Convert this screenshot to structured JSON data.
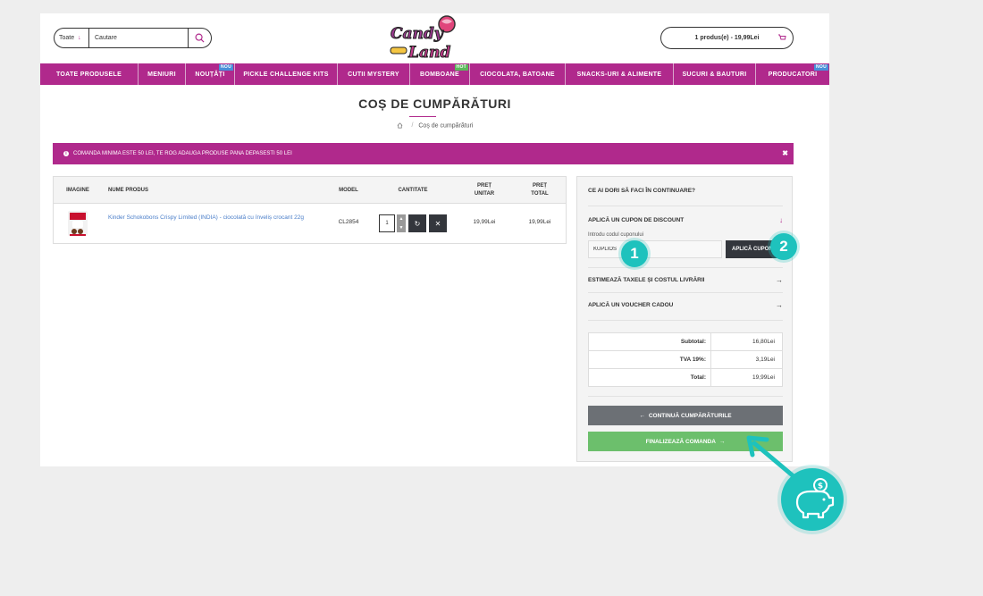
{
  "header": {
    "search": {
      "category": "Toate",
      "placeholder": "Cautare"
    },
    "cart_summary": "1 produs(e) - 19,99Lei"
  },
  "nav": {
    "items": [
      {
        "label": "TOATE PRODUSELE",
        "badge": ""
      },
      {
        "label": "MENIURI",
        "badge": ""
      },
      {
        "label": "NOUȚĂȚI",
        "badge": "NOU"
      },
      {
        "label": "PICKLE CHALLENGE KITS",
        "badge": ""
      },
      {
        "label": "CUTII MYSTERY",
        "badge": ""
      },
      {
        "label": "BOMBOANE",
        "badge": "HOT"
      },
      {
        "label": "CIOCOLATA, BATOANE",
        "badge": ""
      },
      {
        "label": "SNACKS-URI & ALIMENTE",
        "badge": ""
      },
      {
        "label": "SUCURI & BAUTURI",
        "badge": ""
      },
      {
        "label": "PRODUCATORI",
        "badge": "NOU"
      }
    ]
  },
  "page": {
    "title": "COȘ DE CUMPĂRĂTURI",
    "breadcrumb": "Coș de cumpărături",
    "alert": "COMANDA MINIMA ESTE 50 LEI, TE ROG ADAUGA PRODUSE PANA DEPASESTI 50 LEI"
  },
  "cart_table": {
    "headers": {
      "image": "IMAGINE",
      "name": "NUME PRODUS",
      "model": "MODEL",
      "quantity": "CANTITATE",
      "unit_price": "PREȚ UNITAR",
      "total_price": "PREȚ TOTAL"
    },
    "rows": [
      {
        "name": "Kinder Schokobons Crispy Limited (INDIA) - ciocolată cu înveliș crocant 22g",
        "model": "CL2854",
        "quantity": "1",
        "unit_price": "19,99Lei",
        "total_price": "19,99Lei"
      }
    ]
  },
  "side": {
    "heading": "CE AI DORI SĂ FACI ÎN CONTINUARE?",
    "coupon": {
      "title": "APLICĂ UN CUPON DE DISCOUNT",
      "label": "Introdu codul cuponului",
      "value": "KUPLIOS",
      "button": "APLICĂ CUPON"
    },
    "shipping": "ESTIMEAZĂ TAXELE ȘI COSTUL LIVRĂRII",
    "voucher": "APLICĂ UN VOUCHER CADOU",
    "totals": [
      {
        "label": "Subtotal:",
        "value": "16,80Lei"
      },
      {
        "label": "TVA 19%:",
        "value": "3,19Lei"
      },
      {
        "label": "Total:",
        "value": "19,99Lei"
      }
    ],
    "continue_button": "CONTINUĂ CUMPĂRĂTURILE",
    "checkout_button": "FINALIZEAZĂ COMANDA"
  },
  "overlay": {
    "step1": "1",
    "step2": "2",
    "accent": "#1ec2bd"
  },
  "colors": {
    "brand": "#b0298c",
    "dark": "#33363c",
    "green": "#6cbf6c"
  }
}
